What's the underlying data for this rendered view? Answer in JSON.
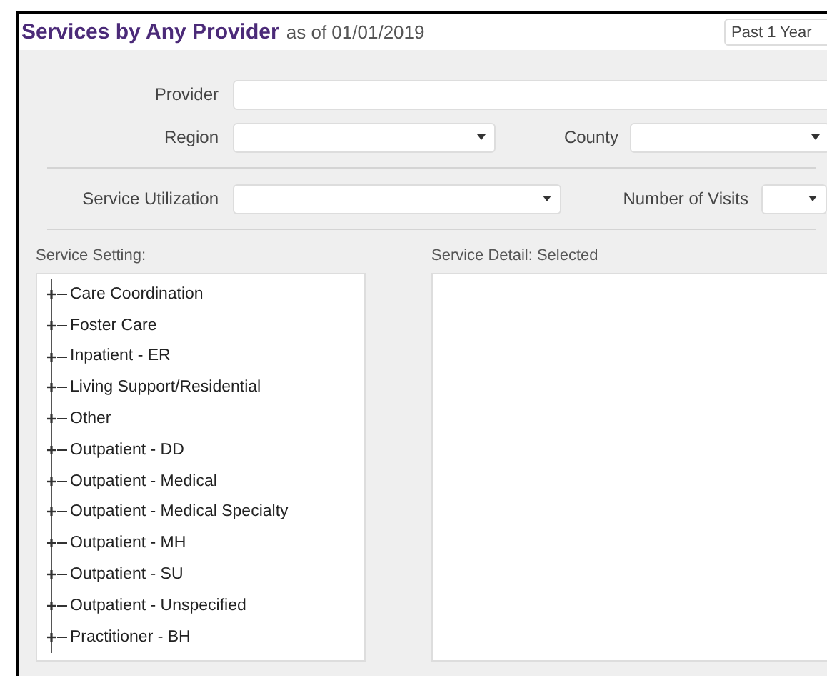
{
  "header": {
    "title": "Services by Any Provider",
    "as_of": "as of 01/01/2019",
    "period": "Past 1 Year"
  },
  "fields": {
    "provider": {
      "label": "Provider"
    },
    "region": {
      "label": "Region"
    },
    "county": {
      "label": "County"
    },
    "service_utilization": {
      "label": "Service Utilization"
    },
    "number_of_visits": {
      "label": "Number of Visits"
    }
  },
  "service_setting": {
    "label": "Service Setting:",
    "items": [
      {
        "label": "Care Coordination",
        "expanded": false
      },
      {
        "label": "Foster Care",
        "expanded": false
      },
      {
        "label": "Inpatient - ER",
        "expanded": false
      },
      {
        "label": "Living Support/Residential",
        "expanded": false
      },
      {
        "label": "Other",
        "expanded": false
      },
      {
        "label": "Outpatient - DD",
        "expanded": false
      },
      {
        "label": "Outpatient - Medical",
        "expanded": false
      },
      {
        "label": "Outpatient - Medical Specialty",
        "expanded": false
      },
      {
        "label": "Outpatient - MH",
        "expanded": false
      },
      {
        "label": "Outpatient - SU",
        "expanded": false
      },
      {
        "label": "Outpatient - Unspecified",
        "expanded": false
      },
      {
        "label": "Practitioner - BH",
        "expanded": false
      }
    ]
  },
  "service_detail": {
    "label": "Service Detail: Selected"
  }
}
